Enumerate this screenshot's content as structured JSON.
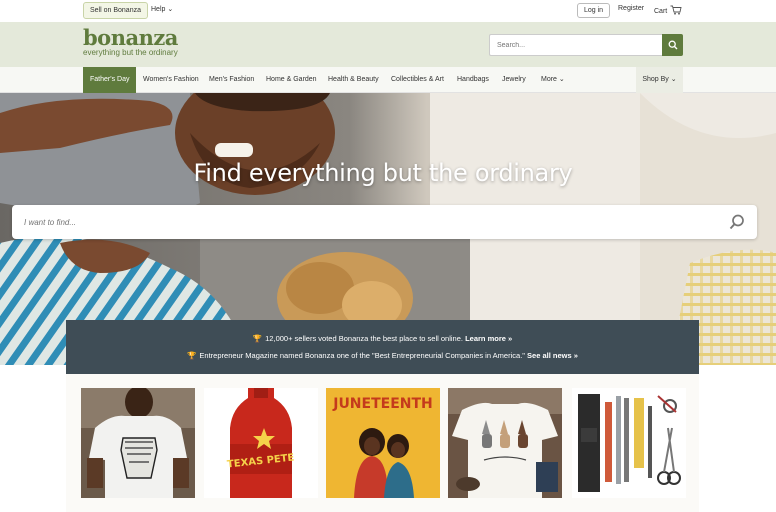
{
  "topbar": {
    "sell_label": "Sell on Bonanza",
    "help_label": "Help",
    "login_label": "Log in",
    "register_label": "Register",
    "cart_label": "Cart"
  },
  "header": {
    "logo_word": "bonanza",
    "logo_tagline": "everything but the ordinary",
    "search_placeholder": "Search..."
  },
  "nav": {
    "items": [
      {
        "label": "Father's Day"
      },
      {
        "label": "Women's Fashion"
      },
      {
        "label": "Men's Fashion"
      },
      {
        "label": "Home & Garden"
      },
      {
        "label": "Health & Beauty"
      },
      {
        "label": "Collectibles & Art"
      },
      {
        "label": "Handbags"
      },
      {
        "label": "Jewelry"
      },
      {
        "label": "More"
      }
    ],
    "shop_by_label": "Shop By"
  },
  "hero": {
    "title": "Find everything but the ordinary",
    "search_placeholder": "I want to find..."
  },
  "banner": {
    "line1_text": "12,000+ sellers voted Bonanza the best place to sell online.",
    "line1_link": "Learn more »",
    "line2_text": "Entrepreneur Magazine named Bonanza one of the \"Best Entrepreneurial Companies in America.\"",
    "line2_link": "See all news »"
  },
  "products": [
    {
      "caption": ""
    },
    {
      "caption": "TEXAS PETE"
    },
    {
      "caption": "JUNETEENTH"
    },
    {
      "caption": ""
    },
    {
      "caption": ""
    }
  ],
  "colors": {
    "brand_green": "#5f7b3d",
    "header_bg": "#e4e9da",
    "banner_bg": "#3f4d56"
  }
}
